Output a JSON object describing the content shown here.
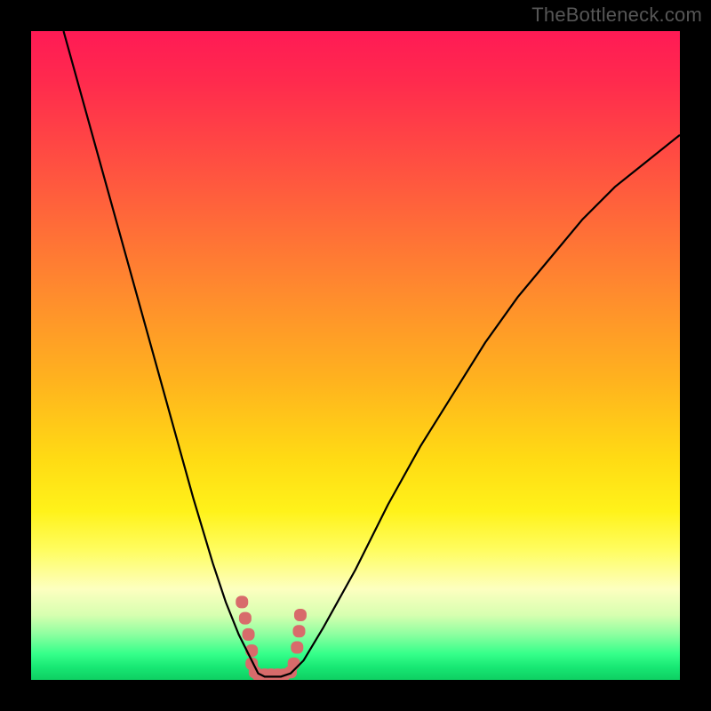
{
  "watermark": "TheBottleneck.com",
  "chart_data": {
    "type": "line",
    "title": "",
    "xlabel": "",
    "ylabel": "",
    "xlim": [
      0,
      100
    ],
    "ylim": [
      0,
      100
    ],
    "grid": false,
    "legend": false,
    "background_gradient": {
      "top": "#ff1a55",
      "middle": "#ffdb14",
      "bottom": "#18e874"
    },
    "series": [
      {
        "name": "bottleneck-curve",
        "color": "#000000",
        "x": [
          5,
          10,
          15,
          20,
          25,
          28,
          30,
          32,
          34,
          35,
          36,
          37,
          38.5,
          40,
          42,
          45,
          50,
          55,
          60,
          65,
          70,
          75,
          80,
          85,
          90,
          95,
          100
        ],
        "values": [
          100,
          82,
          64,
          46,
          28,
          18,
          12,
          7,
          3,
          1,
          0.5,
          0.5,
          0.5,
          1,
          3,
          8,
          17,
          27,
          36,
          44,
          52,
          59,
          65,
          71,
          76,
          80,
          84
        ]
      }
    ],
    "highlight_region": {
      "name": "optimal-zone-marker",
      "color": "#d86b6b",
      "x": [
        32.5,
        33,
        33.5,
        34,
        34,
        34.5,
        35,
        36,
        37,
        38,
        39,
        40,
        40.5,
        41,
        41.3,
        41.5
      ],
      "values": [
        12,
        9.5,
        7,
        4.5,
        2.5,
        1.2,
        0.8,
        0.8,
        0.8,
        0.8,
        0.8,
        1.2,
        2.5,
        5,
        7.5,
        10
      ]
    }
  }
}
